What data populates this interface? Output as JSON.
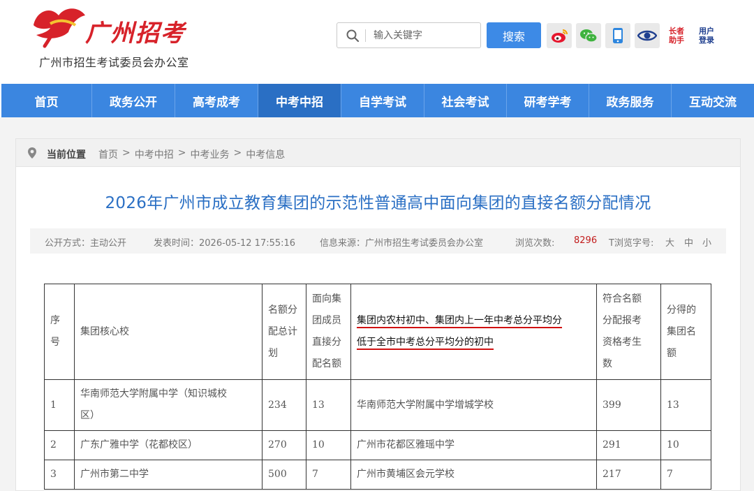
{
  "header": {
    "logo_brand": "广州招考",
    "logo_org": "广州市招生考试委员会办公室",
    "search_placeholder": "输入关键字",
    "search_button": "搜索",
    "changbei_label_1": "长者",
    "changbei_label_2": "助手",
    "login_label_1": "用户",
    "login_label_2": "登录"
  },
  "nav": [
    "首页",
    "政务公开",
    "高考成考",
    "中考中招",
    "自学考试",
    "社会考试",
    "研考学考",
    "政务服务",
    "互动交流"
  ],
  "breadcrumb": {
    "label": "当前位置",
    "items": [
      "首页",
      ">",
      "中考中招",
      ">",
      "中考业务",
      ">",
      "中考信息"
    ]
  },
  "article": {
    "title": "2026年广州市成立教育集团的示范性普通高中面向集团的直接名额分配情况",
    "disclosure": "公开方式：主动公开",
    "publish_time": "发表时间：2026-05-12 17:55:16",
    "source": "信息来源：广州市招生考试委员会办公室",
    "views_label": "浏览次数:",
    "views": "8296",
    "font_size_label": "T浏览字号:",
    "font_large": "大",
    "font_medium": "中",
    "font_small": "小"
  },
  "table": {
    "headers": {
      "no_1": "序",
      "no_2": "号",
      "core": "集团核心校",
      "total_1": "名额分",
      "total_2": "配总计",
      "total_3": "划",
      "direct_1": "面向集",
      "direct_2": "团成员",
      "direct_3": "直接分",
      "direct_4": "配名额",
      "member_1": "集团内农村初中、集团内上一年中考总分平均分",
      "member_2": "低于全市中考总分平均分的初中",
      "eligible_1": "符合名额",
      "eligible_2": "分配报考",
      "eligible_3": "资格考生",
      "eligible_4": "数",
      "alloc_1": "分得的",
      "alloc_2": "集团名",
      "alloc_3": "额"
    },
    "rows": [
      {
        "no": "1",
        "core_1": "华南师范大学附属中学（知识城校",
        "core_2": "区）",
        "total": "234",
        "direct": "13",
        "member": "华南师范大学附属中学增城学校",
        "eligible": "399",
        "alloc": "13"
      },
      {
        "no": "2",
        "core_1": "广东广雅中学（花都校区）",
        "total": "270",
        "direct": "10",
        "member": "广州市花都区雅瑶中学",
        "eligible": "291",
        "alloc": "10"
      },
      {
        "no": "3",
        "core_1": "广州市第二中学",
        "total": "500",
        "direct": "7",
        "member": "广州市黄埔区会元学校",
        "eligible": "217",
        "alloc": "7"
      }
    ]
  }
}
